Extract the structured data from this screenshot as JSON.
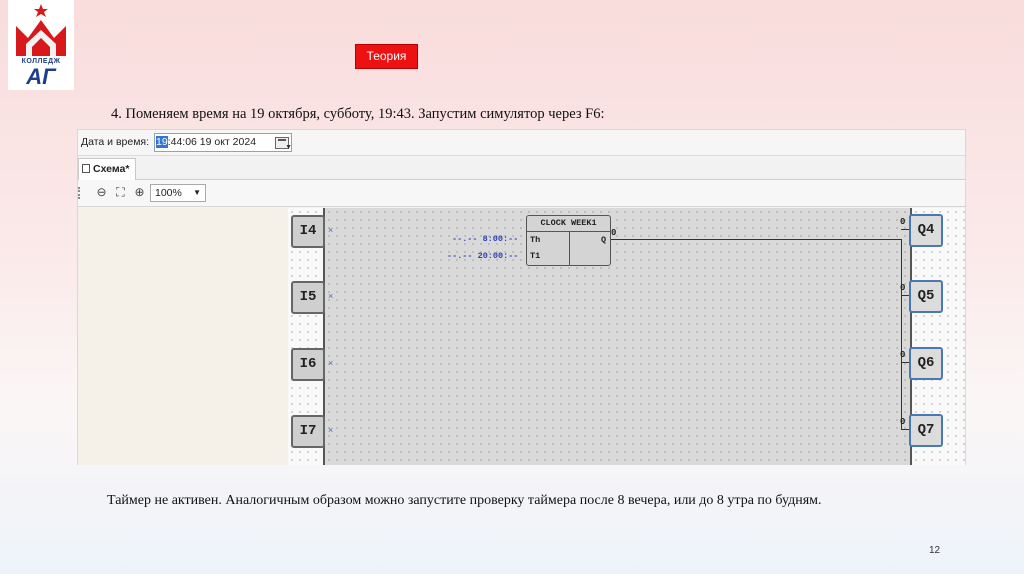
{
  "logo": {
    "word": "КОЛЛЕДЖ",
    "letters": "АГ"
  },
  "theory_button": "Теория",
  "step_text": "4. Поменяем время на 19 октября, субботу, 19:43. Запустим симулятор через F6:",
  "app": {
    "datetime_label": "Дата и время:",
    "datetime_selected": "19",
    "datetime_rest": ":44:06  19  окт  2024",
    "tab_label": "Схема*",
    "zoom_value": "100%",
    "inputs": [
      "I4",
      "I5",
      "I6",
      "I7"
    ],
    "outputs": [
      "Q4",
      "Q5",
      "Q6",
      "Q7"
    ],
    "output_values": [
      "0",
      "0",
      "0",
      "0"
    ],
    "block": {
      "title": "CLOCK WEEK1",
      "pin_th": "Th",
      "pin_t1": "T1",
      "pin_q": "Q",
      "q_value": "0",
      "param_th": "--.-- 8:00:--",
      "param_t1": "--.-- 20:00:--"
    }
  },
  "caption": "Таймер не активен. Аналогичным образом можно запустите проверку таймера после 8 вечера, или до 8 утра по будням.",
  "page_number": "12",
  "colors": {
    "accent": "#ee1111",
    "logo_blue": "#1d3d8f"
  }
}
